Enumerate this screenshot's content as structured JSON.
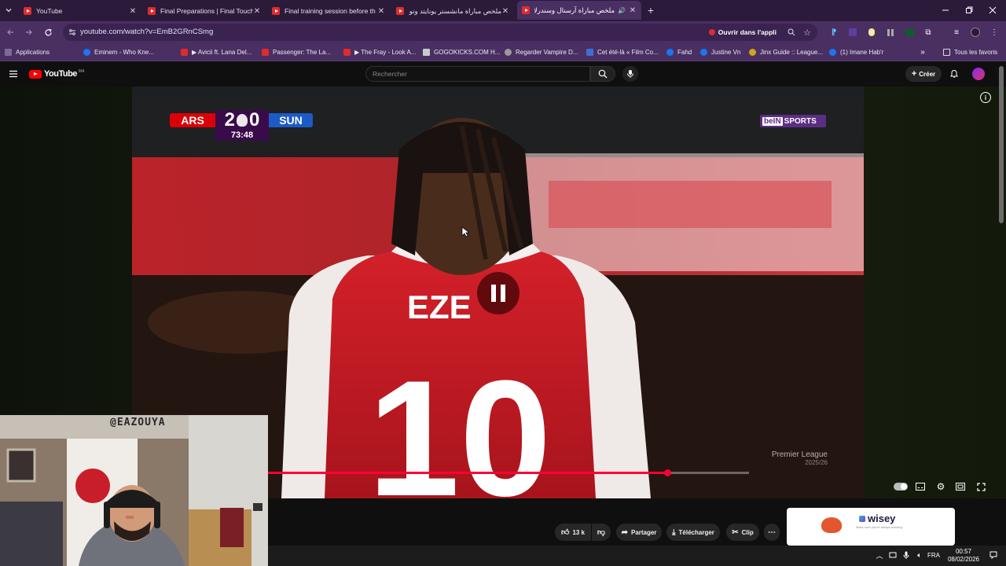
{
  "browser": {
    "tabs": [
      {
        "title": "YouTube"
      },
      {
        "title": "Final Preparations | Final Touch"
      },
      {
        "title": "Final training session before th"
      },
      {
        "title": "ملخص مباراة مانشستر يونايتد وتو"
      },
      {
        "title": "ملخص مباراة آرسنال وسندرلا"
      }
    ],
    "new_tab": "+",
    "url": "youtube.com/watch?v=EmB2GRnCSmg",
    "open_in_app": "Ouvrir dans l'appli",
    "bookmarks": [
      {
        "label": "Applications",
        "color": "#7d6a96"
      },
      {
        "label": "Eminem - Who Kne...",
        "color": "#e12b2b"
      },
      {
        "label": "▶ Avicii ft. Lana Del...",
        "color": "#e12b2b"
      },
      {
        "label": "Passenger: The La...",
        "color": "#e12b2b"
      },
      {
        "label": "▶ The Fray - Look A...",
        "color": "#e12b2b"
      },
      {
        "label": "GOGOKICKS.COM H...",
        "color": "#c9c9c9"
      },
      {
        "label": "Regarder Vampire D...",
        "color": "#9a9a9a"
      },
      {
        "label": "Cet été-là « Film Co...",
        "color": "#3d6fd1"
      },
      {
        "label": "Fahd",
        "color": "#1877f2"
      },
      {
        "label": "Justine Vn",
        "color": "#1877f2"
      },
      {
        "label": "Jinx Guide :: League...",
        "color": "#d4a21c"
      },
      {
        "label": "(1) Imane Hab'r",
        "color": "#1877f2"
      }
    ],
    "all_bookmarks": "Tous les favoris"
  },
  "youtube": {
    "logo_text": "YouTube",
    "logo_sup": "MA",
    "search_placeholder": "Rechercher",
    "create_label": "Créer"
  },
  "video": {
    "scorebug": {
      "home": "ARS",
      "home_score": "2",
      "away_score": "0",
      "away": "SUN",
      "clock": "73:48"
    },
    "broadcaster_a": "beIN",
    "broadcaster_b": "SPORTS",
    "watermark_title": "Premier League",
    "watermark_season": "2025/26",
    "player_name": "EZE",
    "player_number": "10",
    "progress": 0.83,
    "loaded": 1.0
  },
  "actions": {
    "likes": "13 k",
    "share": "Partager",
    "download": "Télécharger",
    "clip": "Clip"
  },
  "ad": {
    "brand": "wisey",
    "tagline": "Make sure you're always working"
  },
  "webcam": {
    "handle": "@EAZOUYA"
  },
  "taskbar": {
    "lang": "FRA",
    "time": "00:57",
    "date": "08/02/2026"
  },
  "colors": {
    "accent_red": "#ff0033",
    "arsenal_red": "#db0007",
    "browser_purple": "#4a2f62",
    "bein_purple": "#5b2d84"
  }
}
